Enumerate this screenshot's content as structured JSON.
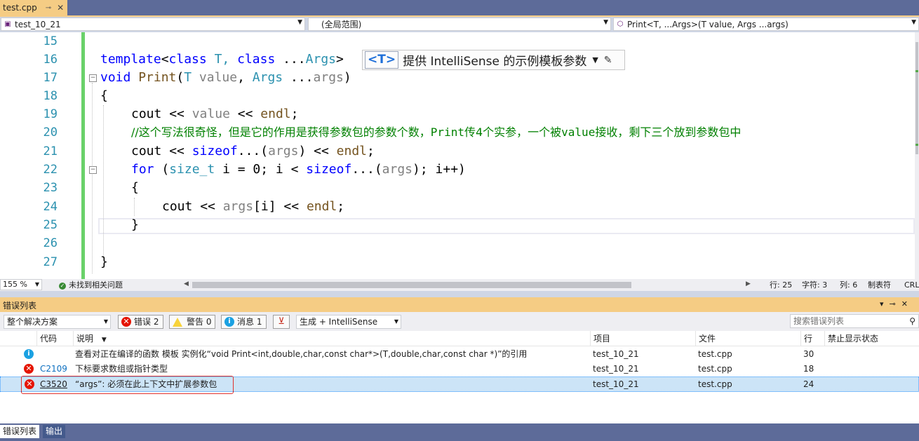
{
  "tab": {
    "file": "test.cpp",
    "pin": "⊸",
    "close": "✕"
  },
  "navbar": {
    "project": "test_10_21",
    "scope": "(全局范围)",
    "member": "Print<T, ...Args>(T value, Args ...args)"
  },
  "editor": {
    "line_numbers": [
      "15",
      "16",
      "17",
      "18",
      "19",
      "20",
      "21",
      "22",
      "23",
      "24",
      "25",
      "26",
      "27"
    ],
    "hint": {
      "tag": "<T>",
      "text": "提供 IntelliSense 的示例模板参数"
    },
    "code": {
      "l16": [
        "template",
        "<",
        "class",
        " T, ",
        "class",
        " ...",
        "Args",
        ">"
      ],
      "l17": [
        "void",
        " ",
        "Print",
        "(",
        "T",
        " ",
        "value",
        ", ",
        "Args",
        " ...",
        "args",
        ")"
      ],
      "l18": "{",
      "l19": [
        "cout",
        " << ",
        "value",
        " << ",
        "endl",
        ";"
      ],
      "l20": [
        "//这个写法很奇怪，但是它的作用是获得参数包的参数个数，",
        "Print",
        "传4个实参，一个被",
        "value",
        "接收，剩下三个放到参数包中"
      ],
      "l21": [
        "cout",
        " << ",
        "sizeof",
        "...(",
        "args",
        ") << ",
        "endl",
        ";"
      ],
      "l22": [
        "for",
        " (",
        "size_t",
        " i = 0; i < ",
        "sizeof",
        "...(",
        "args",
        "); i++)"
      ],
      "l23": "{",
      "l24": [
        "cout",
        " << ",
        "args",
        "[i] << ",
        "endl",
        ";"
      ],
      "l25": "}",
      "l27": "}"
    }
  },
  "editor_status": {
    "zoom": "155 %",
    "issues": "未找到相关问题",
    "row": "行: 25",
    "char": "字符: 3",
    "col": "列: 6",
    "tabs": "制表符",
    "eol": "CRL"
  },
  "error_list": {
    "title": "错误列表",
    "scope_filter": "整个解决方案",
    "errors_btn": "错误 2",
    "warnings_btn": "警告 0",
    "messages_btn": "消息 1",
    "build_filter": "生成 + IntelliSense",
    "search_placeholder": "搜索错误列表",
    "columns": {
      "code": "代码",
      "desc": "说明",
      "project": "项目",
      "file": "文件",
      "line": "行",
      "suppress": "禁止显示状态"
    },
    "rows": [
      {
        "icon": "info",
        "code": "",
        "desc": "查看对正在编译的函数 模板 实例化“void Print<int,double,char,const char*>(T,double,char,const char *)”的引用",
        "project": "test_10_21",
        "file": "test.cpp",
        "line": "30"
      },
      {
        "icon": "error",
        "code": "C2109",
        "desc": "下标要求数组或指针类型",
        "project": "test_10_21",
        "file": "test.cpp",
        "line": "18"
      },
      {
        "icon": "error",
        "code": "C3520",
        "desc": "“args”: 必须在此上下文中扩展参数包",
        "project": "test_10_21",
        "file": "test.cpp",
        "line": "24"
      }
    ]
  },
  "bottom_tabs": [
    "错误列表",
    "输出"
  ]
}
